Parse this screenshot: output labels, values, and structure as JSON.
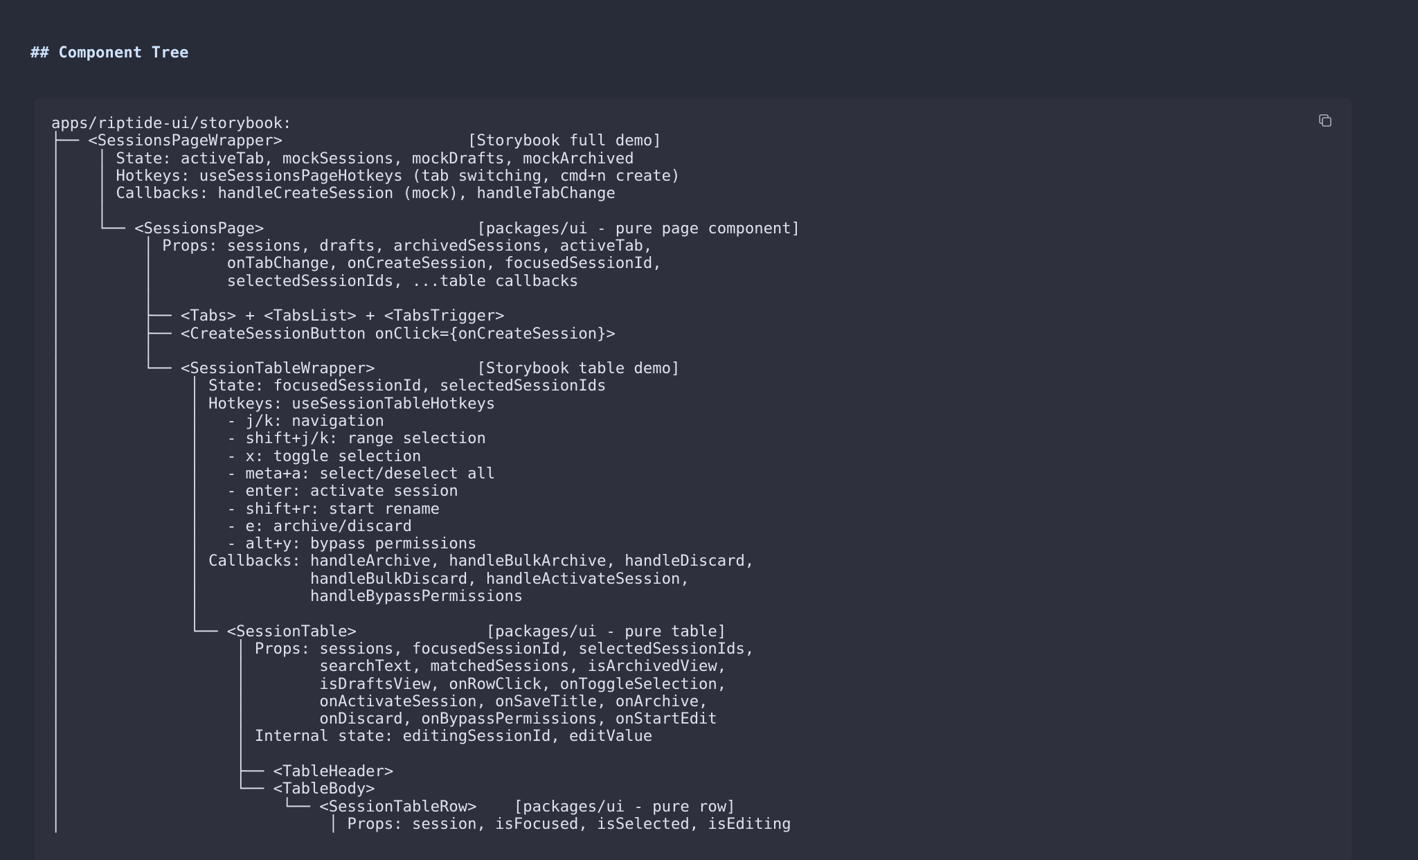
{
  "section_heading": "## Component Tree",
  "code_block": {
    "copy_icon": "copy-icon",
    "lines": [
      "apps/riptide-ui/storybook:",
      "├── <SessionsPageWrapper>                    [Storybook full demo]",
      "│    │ State: activeTab, mockSessions, mockDrafts, mockArchived",
      "│    │ Hotkeys: useSessionsPageHotkeys (tab switching, cmd+n create)",
      "│    │ Callbacks: handleCreateSession (mock), handleTabChange",
      "│    │",
      "│    └── <SessionsPage>                       [packages/ui - pure page component]",
      "│         │ Props: sessions, drafts, archivedSessions, activeTab,",
      "│         │        onTabChange, onCreateSession, focusedSessionId,",
      "│         │        selectedSessionIds, ...table callbacks",
      "│         │",
      "│         ├── <Tabs> + <TabsList> + <TabsTrigger>",
      "│         ├── <CreateSessionButton onClick={onCreateSession}>",
      "│         │",
      "│         └── <SessionTableWrapper>           [Storybook table demo]",
      "│              │ State: focusedSessionId, selectedSessionIds",
      "│              │ Hotkeys: useSessionTableHotkeys",
      "│              │   - j/k: navigation",
      "│              │   - shift+j/k: range selection",
      "│              │   - x: toggle selection",
      "│              │   - meta+a: select/deselect all",
      "│              │   - enter: activate session",
      "│              │   - shift+r: start rename",
      "│              │   - e: archive/discard",
      "│              │   - alt+y: bypass permissions",
      "│              │ Callbacks: handleArchive, handleBulkArchive, handleDiscard,",
      "│              │            handleBulkDiscard, handleActivateSession,",
      "│              │            handleBypassPermissions",
      "│              │",
      "│              └── <SessionTable>              [packages/ui - pure table]",
      "│                   │ Props: sessions, focusedSessionId, selectedSessionIds,",
      "│                   │        searchText, matchedSessions, isArchivedView,",
      "│                   │        isDraftsView, onRowClick, onToggleSelection,",
      "│                   │        onActivateSession, onSaveTitle, onArchive,",
      "│                   │        onDiscard, onBypassPermissions, onStartEdit",
      "│                   │ Internal state: editingSessionId, editValue",
      "│                   │",
      "│                   ├── <TableHeader>",
      "│                   └── <TableBody>",
      "│                        └── <SessionTableRow>    [packages/ui - pure row]",
      "│                             │ Props: session, isFocused, isSelected, isEditing"
    ]
  }
}
